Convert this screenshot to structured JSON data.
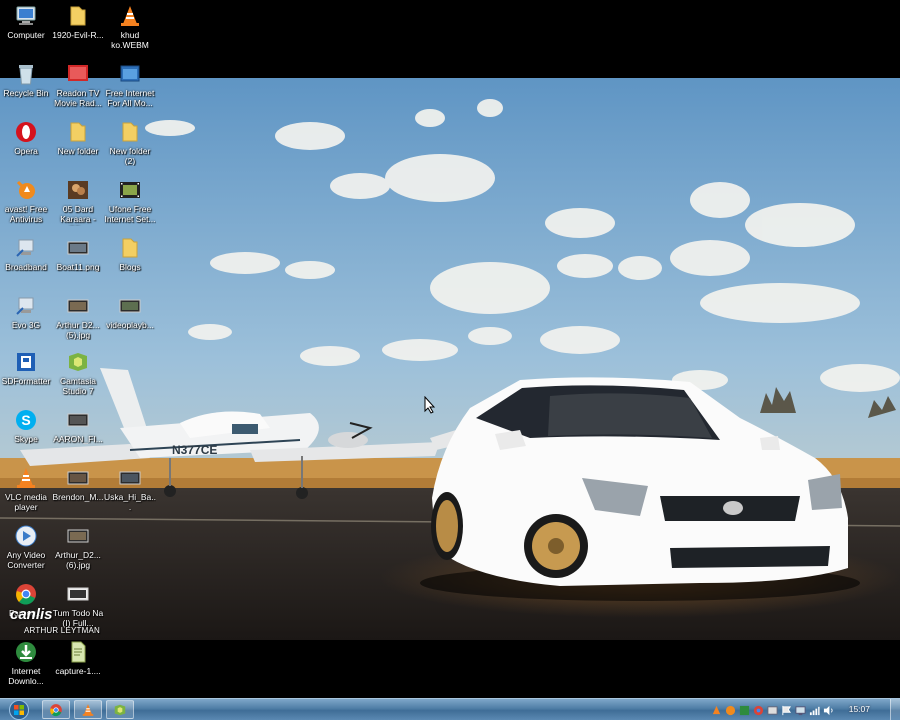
{
  "desktop": {
    "icons": [
      {
        "label": "Computer",
        "icon": "computer-icon"
      },
      {
        "label": "1920-Evil-R...",
        "icon": "folder-icon"
      },
      {
        "label": "khud ko.WEBM",
        "icon": "vlc-cone-icon"
      },
      {
        "label": "Recycle Bin",
        "icon": "recycle-bin-icon"
      },
      {
        "label": "Readon TV Movie Rad...",
        "icon": "readon-tv-icon"
      },
      {
        "label": "Free Internet For All Mo...",
        "icon": "app-window-icon"
      },
      {
        "label": "Opera",
        "icon": "opera-icon"
      },
      {
        "label": "New folder",
        "icon": "folder-icon"
      },
      {
        "label": "New folder (2)",
        "icon": "folder-icon"
      },
      {
        "label": "avast! Free Antivirus",
        "icon": "avast-icon"
      },
      {
        "label": "05 Dard Karaara - (Mi...",
        "icon": "video-thumbnail-icon"
      },
      {
        "label": "Ufone Free Internet Set...",
        "icon": "film-strip-icon"
      },
      {
        "label": "Broadband",
        "icon": "network-shortcut-icon"
      },
      {
        "label": "Boat11.png",
        "icon": "image-file-icon"
      },
      {
        "label": "Blogs",
        "icon": "folder-icon"
      },
      {
        "label": "Evo 3G",
        "icon": "network-shortcut-icon"
      },
      {
        "label": "Arthur D2... (5).jpg",
        "icon": "image-file-icon"
      },
      {
        "label": "videoplayb...",
        "icon": "image-file-icon"
      },
      {
        "label": "SDFormatter",
        "icon": "sdformatter-icon"
      },
      {
        "label": "Camtasia Studio 7",
        "icon": "camtasia-icon"
      },
      {
        "label": "Skype",
        "icon": "skype-icon"
      },
      {
        "label": "AARON_FI...",
        "icon": "image-file-icon"
      },
      {
        "label": "VLC media player",
        "icon": "vlc-cone-icon"
      },
      {
        "label": "Brendon_M...",
        "icon": "image-file-icon"
      },
      {
        "label": "Uska_Hi_Ba...",
        "icon": "image-file-icon"
      },
      {
        "label": "Any Video Converter",
        "icon": "video-converter-icon"
      },
      {
        "label": "Arthur_D2... (6).jpg",
        "icon": "image-file-icon"
      },
      {
        "label": "Faroog...",
        "icon": "chrome-icon"
      },
      {
        "label": "Tum Todo Na (I) Full...",
        "icon": "image-file-icon"
      },
      {
        "label": "Internet Downlo...",
        "icon": "internet-download-manager-icon"
      },
      {
        "label": "capture-1....",
        "icon": "text-file-icon"
      }
    ],
    "watermark": "canlis",
    "watermark_sub": "ARTHUR LEYTMAN",
    "plane_registration": "N377CE"
  },
  "taskbar": {
    "start_button": "windows-start-orb-icon",
    "pinned": [
      "chrome-icon",
      "vlc-cone-icon",
      "camtasia-icon"
    ],
    "tray_icons": [
      "vlc-tray-icon",
      "avast-tray-icon",
      "app-tray-icon",
      "network-tray-icon",
      "app-tray-icon",
      "flag-tray-icon",
      "app-tray-icon",
      "signal-tray-icon",
      "volume-icon"
    ],
    "clock": "15:07"
  },
  "colors": {
    "taskbar": "#4f7ea6",
    "sky": "#7fb0d6",
    "car": "#ffffff"
  }
}
